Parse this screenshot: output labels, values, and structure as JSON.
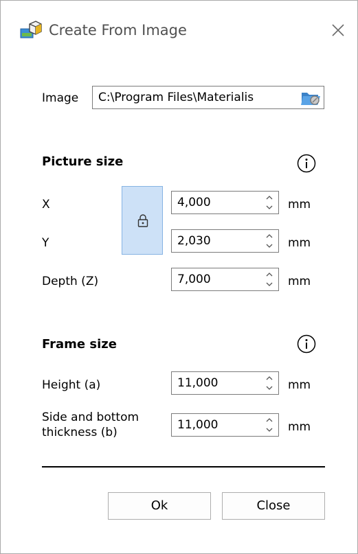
{
  "dialog": {
    "title": "Create From Image",
    "icons": {
      "app": "create-from-image-icon",
      "close": "close-icon"
    }
  },
  "image": {
    "label": "Image",
    "path": "C:\\Program Files\\Materialis",
    "browse_icon": "folder-icon"
  },
  "picture_size": {
    "heading": "Picture size",
    "info_icon": "info-icon",
    "x": {
      "label": "X",
      "value": "4,000",
      "unit": "mm"
    },
    "y": {
      "label": "Y",
      "value": "2,030",
      "unit": "mm"
    },
    "depth": {
      "label": "Depth (Z)",
      "value": "7,000",
      "unit": "mm"
    },
    "lock_icon": "lock-icon"
  },
  "frame_size": {
    "heading": "Frame size",
    "info_icon": "info-icon",
    "height": {
      "label": "Height (a)",
      "value": "11,000",
      "unit": "mm"
    },
    "thickness": {
      "label_line1": "Side and bottom",
      "label_line2": "thickness (b)",
      "value": "11,000",
      "unit": "mm"
    }
  },
  "buttons": {
    "ok": "Ok",
    "close": "Close"
  },
  "colors": {
    "lock_bg": "#cde1f7",
    "lock_border": "#86b3e3",
    "title_text": "#505050"
  }
}
